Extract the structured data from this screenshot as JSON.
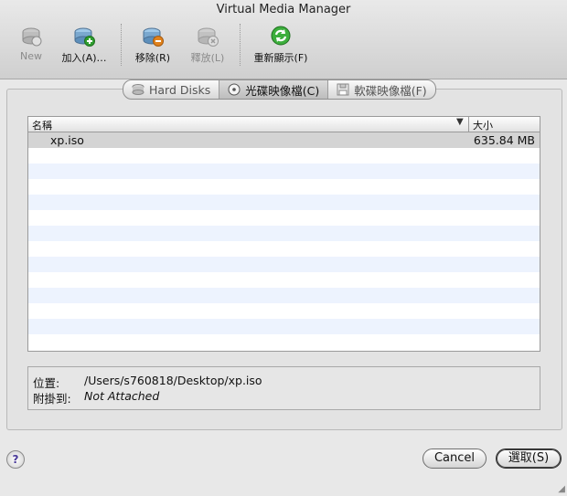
{
  "window": {
    "title": "Virtual Media Manager"
  },
  "toolbar": {
    "new_label": "New",
    "add_label": "加入(A)…",
    "remove_label": "移除(R)",
    "release_label": "釋放(L)",
    "refresh_label": "重新顯示(F)"
  },
  "tabs": [
    {
      "label": "Hard Disks",
      "icon": "hard-disk-icon",
      "active": false
    },
    {
      "label": "光碟映像檔(C)",
      "icon": "cd-icon",
      "active": true
    },
    {
      "label": "軟碟映像檔(F)",
      "icon": "floppy-icon",
      "active": false
    }
  ],
  "list": {
    "col_name": "名稱",
    "col_size": "大小",
    "items": [
      {
        "name": "xp.iso",
        "size": "635.84 MB"
      }
    ]
  },
  "info": {
    "location_label": "位置:",
    "location_value": "/Users/s760818/Desktop/xp.iso",
    "attached_label": "附掛到:",
    "attached_value": "Not Attached"
  },
  "buttons": {
    "help": "?",
    "cancel": "Cancel",
    "select": "選取(S)"
  },
  "colors": {
    "row_alt": "#edf3fe",
    "row_selected": "#d4d4d4",
    "refresh_green": "#2e9d2e"
  }
}
